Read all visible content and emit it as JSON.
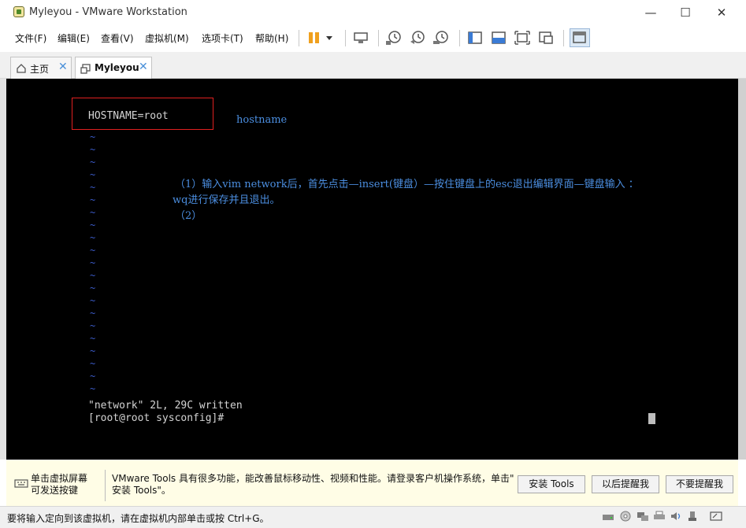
{
  "window": {
    "title": "Myleyou - VMware Workstation",
    "controls": {
      "minimize": "—",
      "maximize": "☐",
      "close": "✕"
    }
  },
  "menu": {
    "items": [
      "文件(F)",
      "编辑(E)",
      "查看(V)",
      "虚拟机(M)",
      "选项卡(T)",
      "帮助(H)"
    ]
  },
  "toolbar": {
    "icons": [
      "pause-icon",
      "dropdown-arrow-icon",
      "send-ctrl-alt-del-icon",
      "snapshot-take-icon",
      "snapshot-revert-icon",
      "snapshot-manager-icon",
      "library-view-icon",
      "console-view-icon",
      "full-screen-icon",
      "unity-icon",
      "thumbnail-view-icon"
    ],
    "accent": "#f0a01e"
  },
  "tabs": [
    {
      "label": "主页",
      "icon": "home-icon",
      "close": "✕"
    },
    {
      "label": "Myleyou",
      "icon": "vm-icon",
      "close": "✕"
    }
  ],
  "console": {
    "hostname_line": "HOSTNAME=root",
    "hostname_note": "hostname",
    "tilde_char": "~",
    "instruction_line1": "（1）输入vim network后，首先点击—insert(键盘）—按住键盘上的esc退出编辑界面—键盘输入 ：",
    "instruction_line2": "wq进行保存并且退出。",
    "instruction_line3": "（2）",
    "written_line": "\"network\" 2L, 29C written",
    "prompt_line": "[root@root sysconfig]#",
    "colors": {
      "background": "#000000",
      "text": "#d4d4d4",
      "tilde": "#3b5bc8",
      "note": "#4b8ee0",
      "box": "#e02020"
    }
  },
  "infobar": {
    "left_label_line1": "单击虚拟屏幕",
    "left_label_line2": "可发送按键",
    "message_line1": "VMware Tools 具有很多功能，能改善鼠标移动性、视频和性能。请登录客户机操作系统，单击\"",
    "message_line2": "安装 Tools\"。",
    "buttons": {
      "install": "安装 Tools",
      "remind_later": "以后提醒我",
      "never_remind": "不要提醒我"
    }
  },
  "statusbar": {
    "text": "要将输入定向到该虚拟机，请在虚拟机内部单击或按 Ctrl+G。",
    "icons": [
      "hard-disk-icon",
      "cd-dvd-icon",
      "network-adapter-icon",
      "printer-icon",
      "sound-card-icon",
      "usb-icon",
      "message-log-icon"
    ]
  }
}
